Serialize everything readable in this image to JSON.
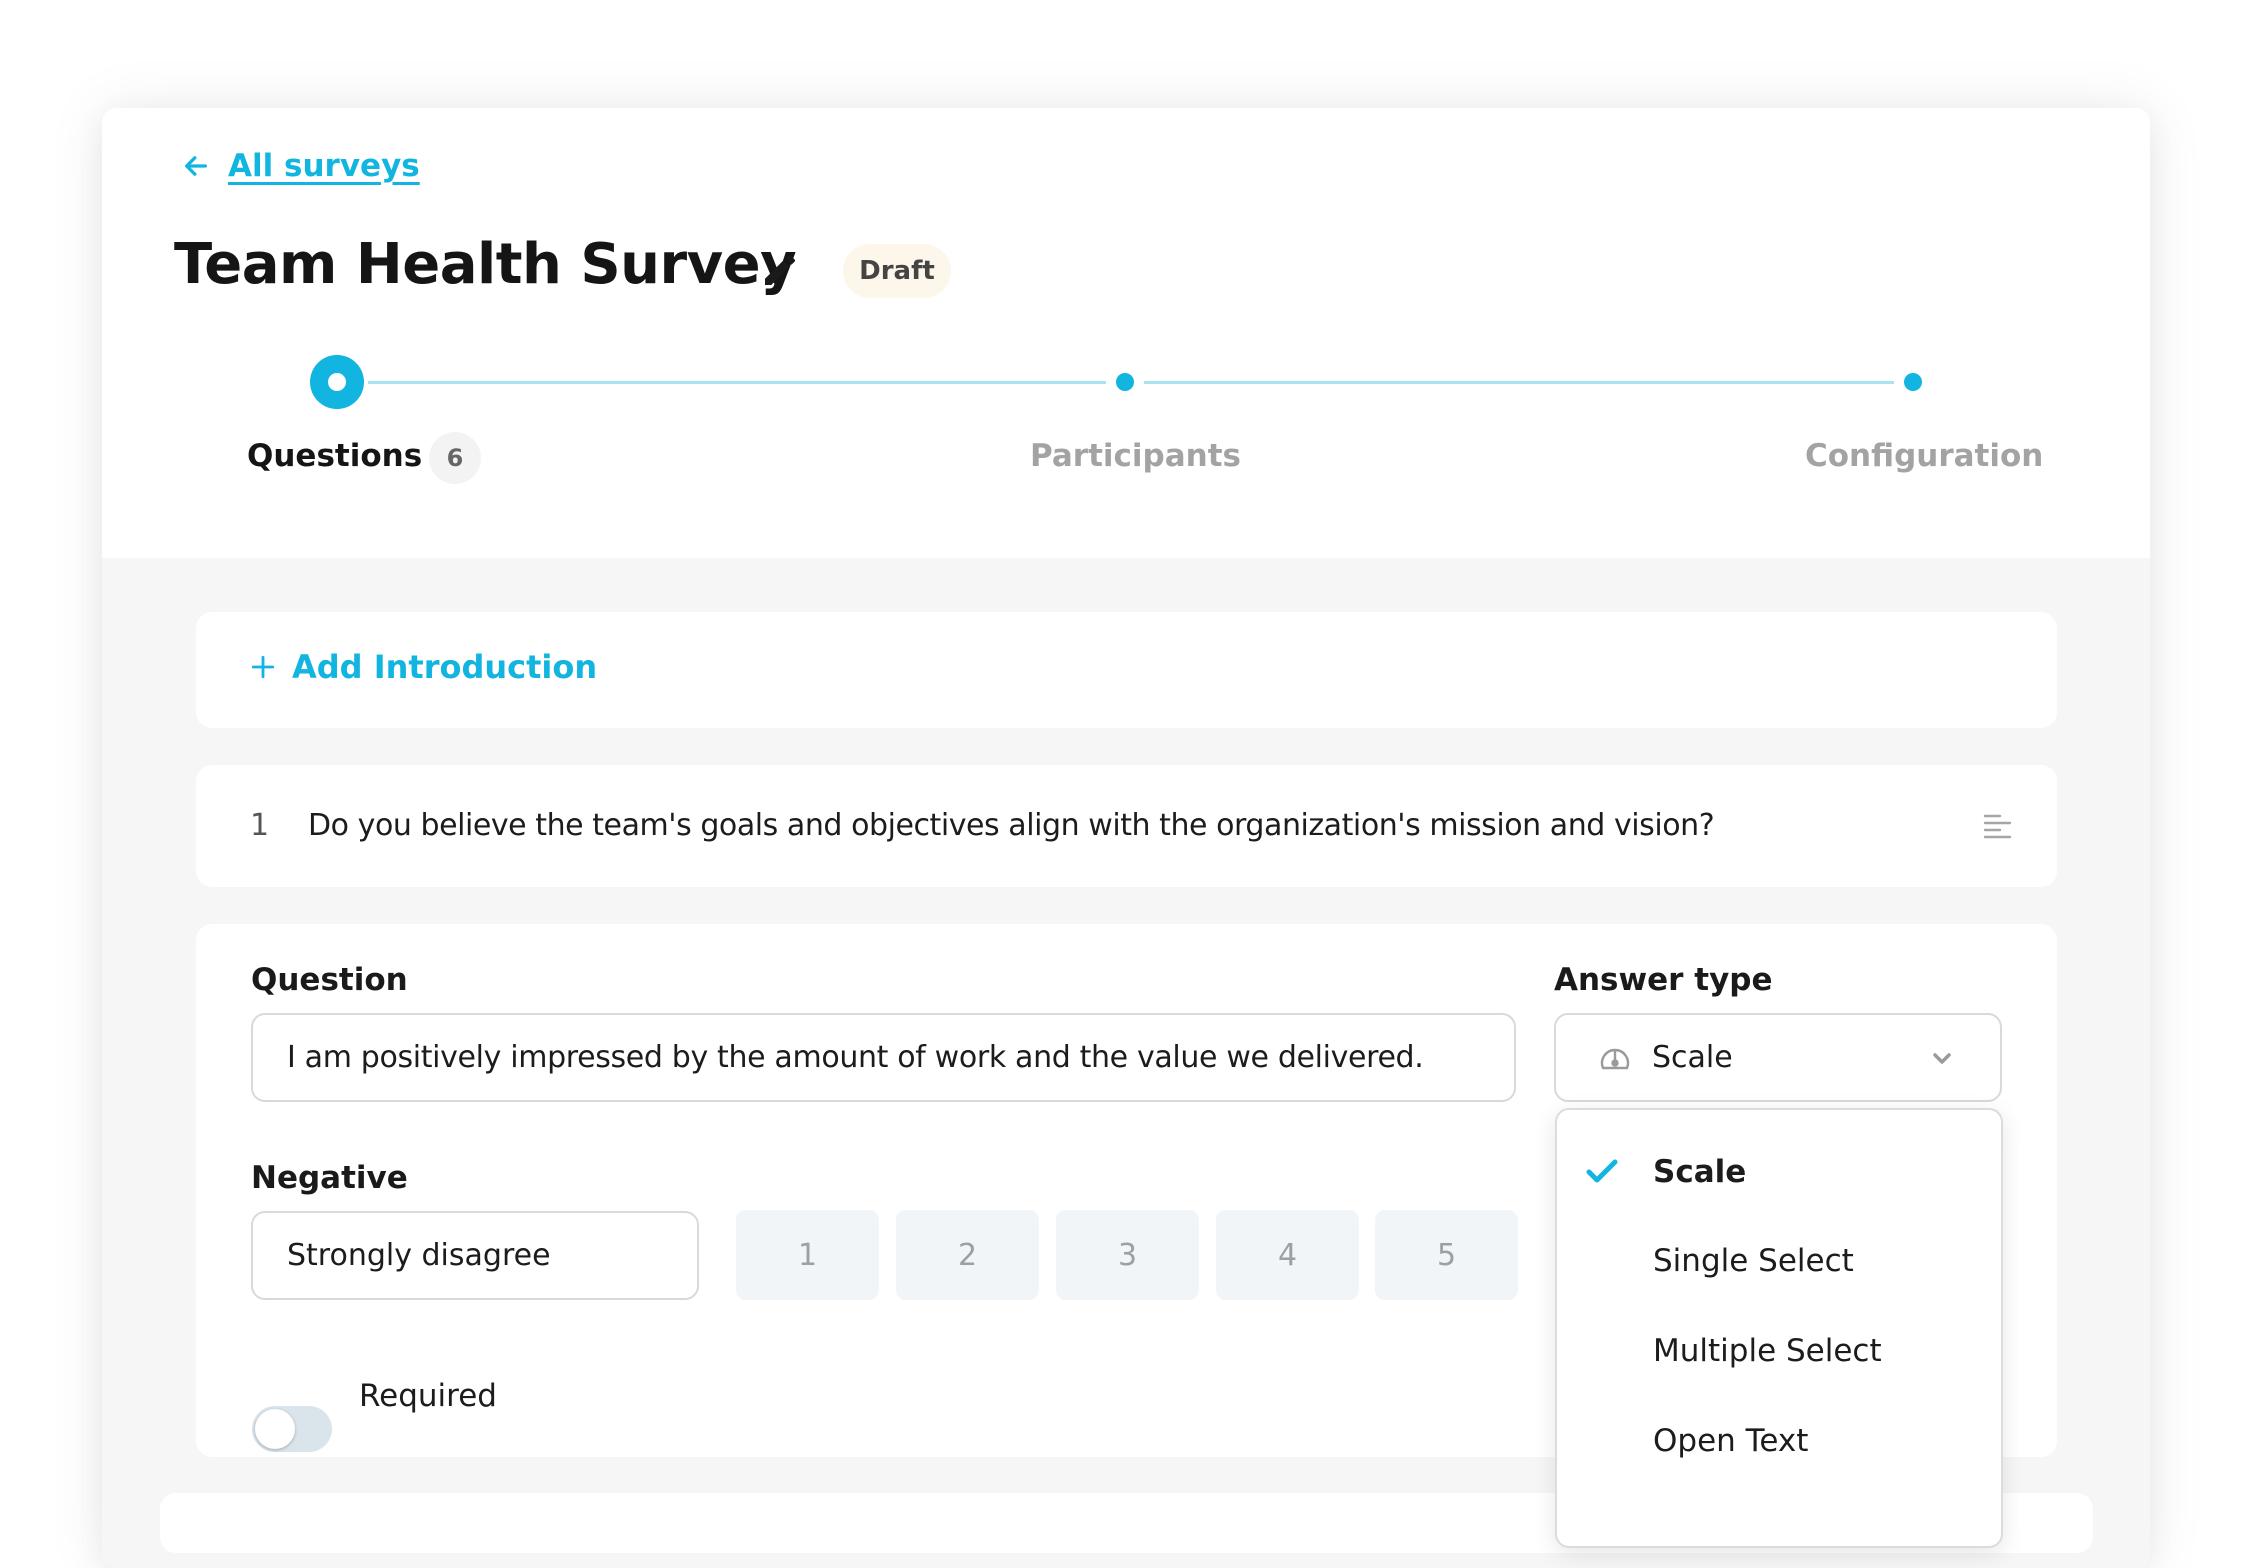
{
  "nav": {
    "back_label": "All surveys"
  },
  "survey": {
    "title": "Team Health Survey",
    "status": "Draft"
  },
  "steps": [
    {
      "label": "Questions",
      "count": "6",
      "state": "active"
    },
    {
      "label": "Participants",
      "state": "inactive"
    },
    {
      "label": "Configuration",
      "state": "inactive"
    }
  ],
  "intro": {
    "add_label": "Add Introduction"
  },
  "questions": [
    {
      "number": "1",
      "text": "Do you believe the team's goals and objectives align with the organization's mission and vision?"
    }
  ],
  "editor": {
    "question_label": "Question",
    "question_value": "I am positively impressed by the amount of work and the value we delivered.",
    "answer_type_label": "Answer type",
    "answer_type_value": "Scale",
    "answer_type_icon": "gauge-icon",
    "negative_label": "Negative",
    "negative_value": "Strongly disagree",
    "scale_values": [
      "1",
      "2",
      "3",
      "4",
      "5"
    ],
    "required_label": "Required",
    "required_on": false
  },
  "answer_type_options": [
    {
      "label": "Scale",
      "selected": true
    },
    {
      "label": "Single Select",
      "selected": false
    },
    {
      "label": "Multiple Select",
      "selected": false
    },
    {
      "label": "Open Text",
      "selected": false
    }
  ],
  "colors": {
    "accent": "#12b5e0",
    "badge_bg": "#fdf6ea",
    "body_bg": "#f6f6f6",
    "scale_box_bg": "#f1f5f8",
    "toggle_off": "#dae4eb"
  }
}
